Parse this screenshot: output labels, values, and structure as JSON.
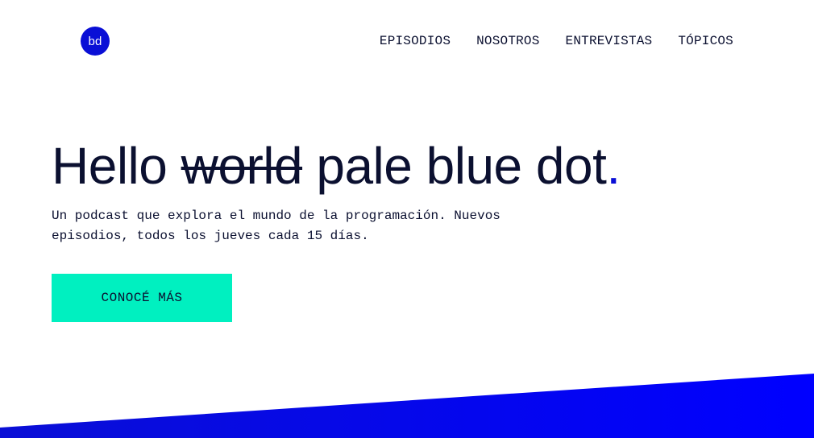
{
  "header": {
    "logo_text": "bd",
    "nav": [
      {
        "label": "EPISODIOS"
      },
      {
        "label": "NOSOTROS"
      },
      {
        "label": "ENTREVISTAS"
      },
      {
        "label": "TÓPICOS"
      }
    ]
  },
  "hero": {
    "headline_prefix": "Hello ",
    "headline_struck": "world",
    "headline_suffix": " pale blue dot",
    "headline_period": ".",
    "subtitle": "Un podcast que explora el mundo de la programación. Nuevos episodios, todos los jueves cada 15 días.",
    "cta_label": "CONOCÉ MÁS"
  },
  "colors": {
    "brand_blue": "#0a0fd6",
    "cta_mint": "#00f0c0",
    "text_dark": "#0b1030"
  }
}
